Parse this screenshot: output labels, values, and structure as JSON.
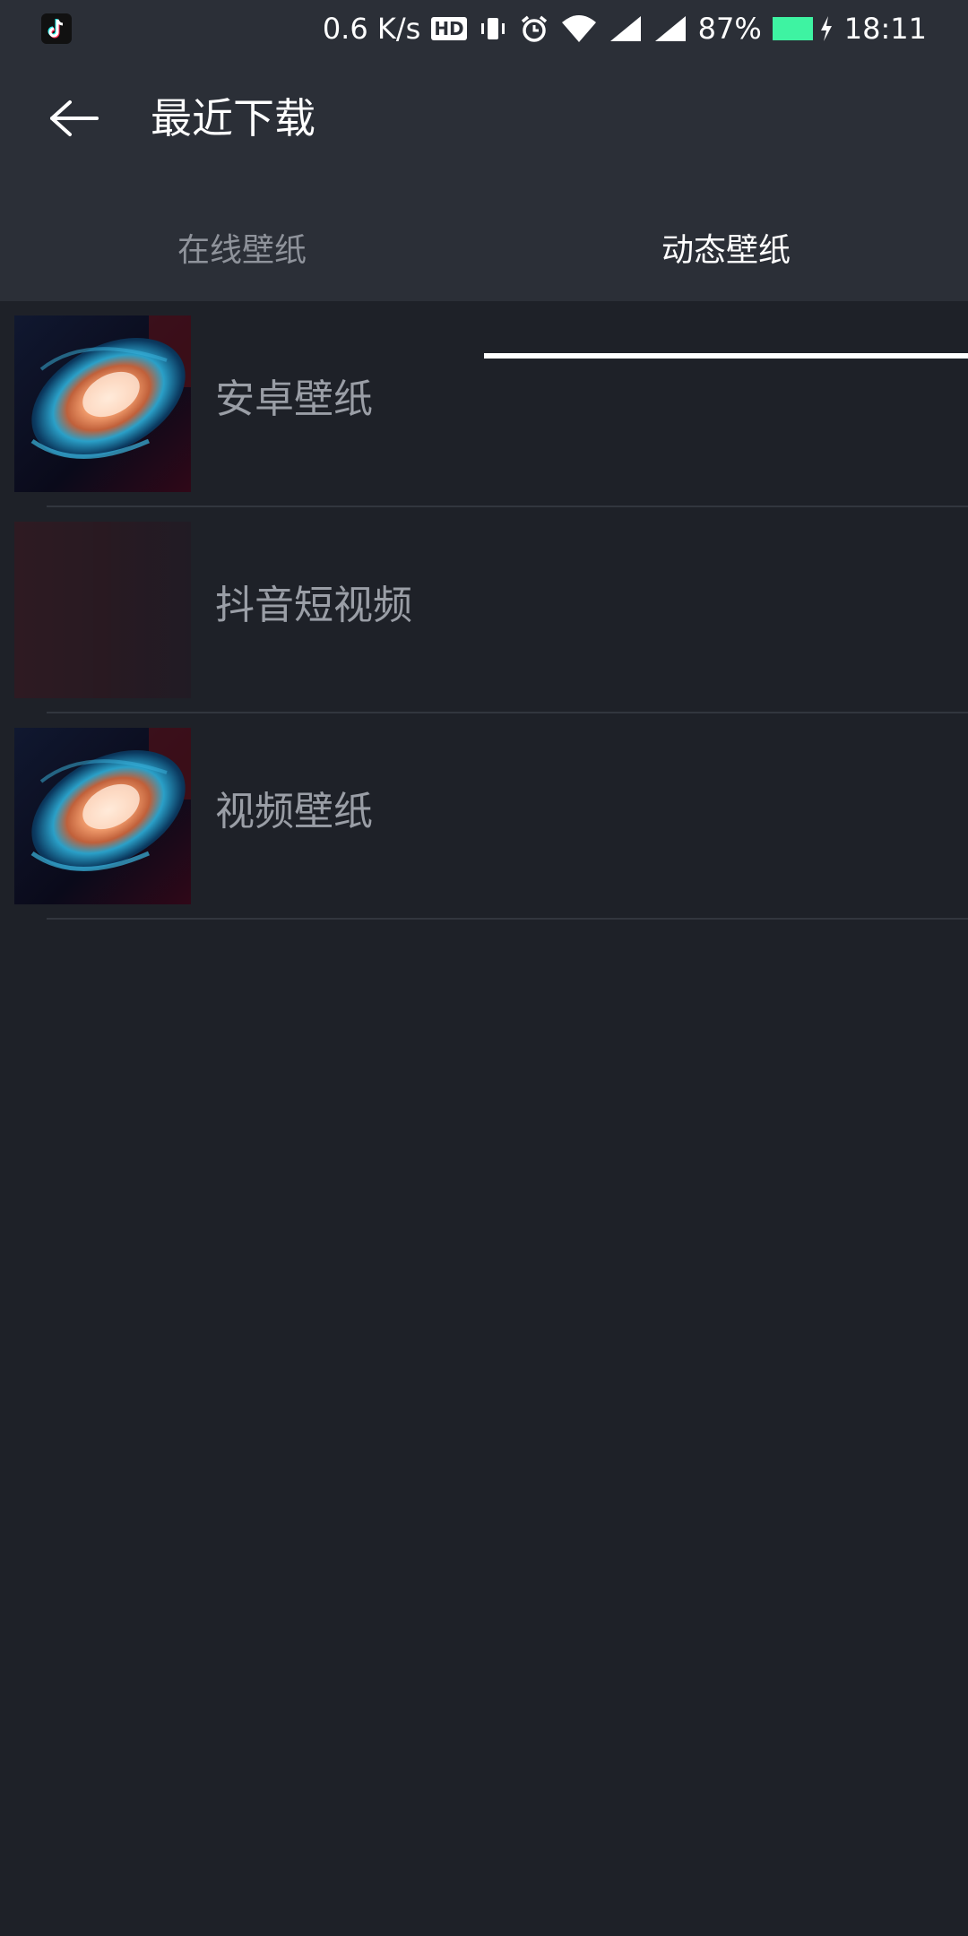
{
  "status_bar": {
    "app_icon": "tiktok-icon",
    "net_speed": "0.6 K/s",
    "hd_badge": "HD",
    "battery_percent": "87%",
    "battery_level": 0.87,
    "time": "18:11",
    "icons": [
      "vibrate-icon",
      "alarm-icon",
      "wifi-icon",
      "signal-icon",
      "signal-icon",
      "charging-icon"
    ]
  },
  "header": {
    "back_icon": "arrow-left-icon",
    "title": "最近下载"
  },
  "tabs": [
    {
      "label": "在线壁纸",
      "active": false
    },
    {
      "label": "动态壁纸",
      "active": true
    }
  ],
  "items": [
    {
      "label": "安卓壁纸",
      "thumbnail": "galaxy"
    },
    {
      "label": "抖音短视频",
      "thumbnail": "dark-red"
    },
    {
      "label": "视频壁纸",
      "thumbnail": "galaxy"
    }
  ],
  "colors": {
    "bar_bg": "#2b2f37",
    "page_bg": "#1e2128",
    "accent_battery": "#3ef3a2",
    "inactive_text": "#8f939b"
  }
}
